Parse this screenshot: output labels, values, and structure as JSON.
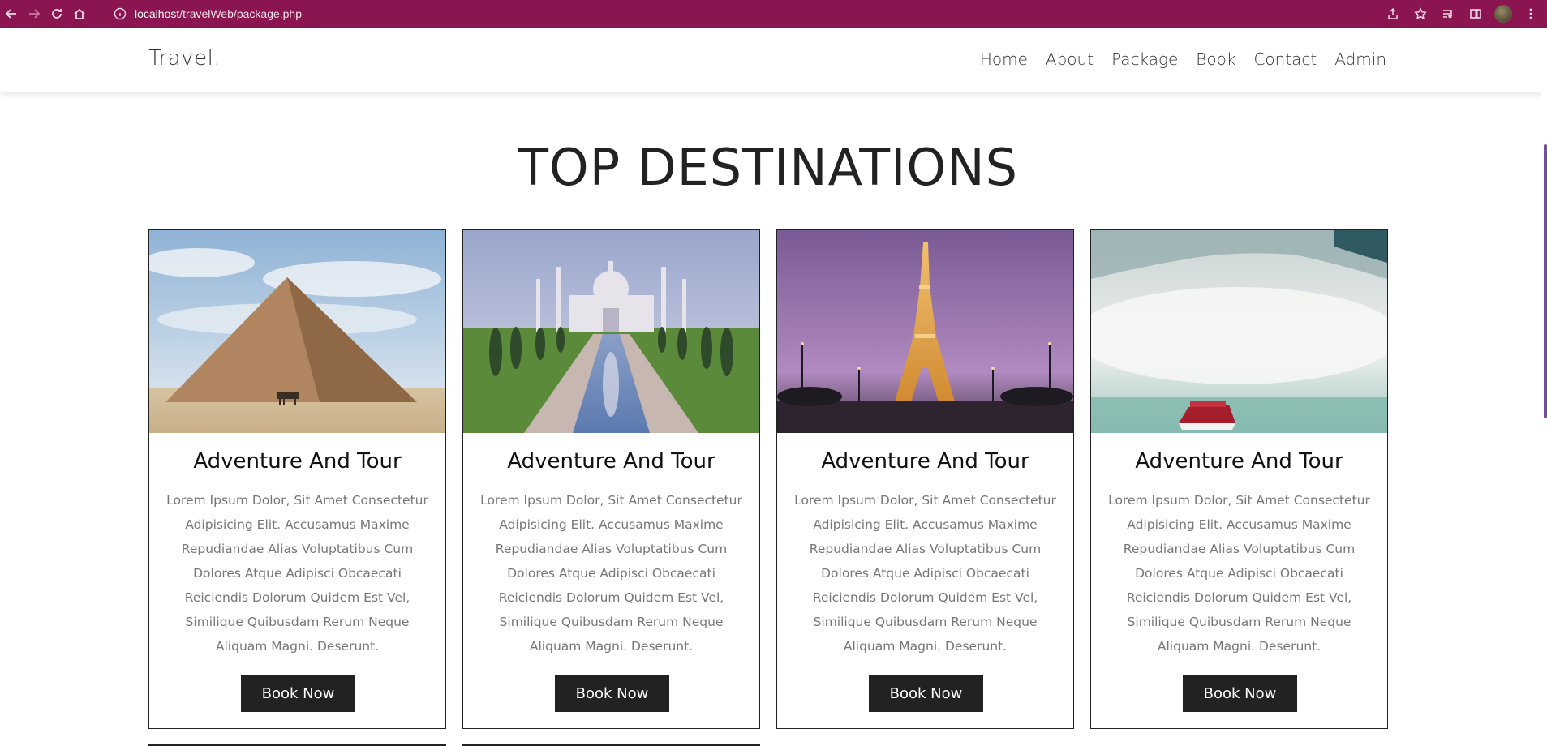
{
  "browser": {
    "url_host": "localhost",
    "url_path": "/travelWeb/package.php"
  },
  "site": {
    "brand": "Travel.",
    "nav": [
      "Home",
      "About",
      "Package",
      "Book",
      "Contact",
      "Admin"
    ]
  },
  "section": {
    "title": "TOP DESTINATIONS"
  },
  "cards": [
    {
      "image": "pyramid-photo",
      "title": "Adventure And Tour",
      "description": "Lorem Ipsum Dolor, Sit Amet Consectetur Adipisicing Elit. Accusamus Maxime Repudiandae Alias Voluptatibus Cum Dolores Atque Adipisci Obcaecati Reiciendis Dolorum Quidem Est Vel, Similique Quibusdam Rerum Neque Aliquam Magni. Deserunt.",
      "button": "Book Now"
    },
    {
      "image": "taj-mahal-photo",
      "title": "Adventure And Tour",
      "description": "Lorem Ipsum Dolor, Sit Amet Consectetur Adipisicing Elit. Accusamus Maxime Repudiandae Alias Voluptatibus Cum Dolores Atque Adipisci Obcaecati Reiciendis Dolorum Quidem Est Vel, Similique Quibusdam Rerum Neque Aliquam Magni. Deserunt.",
      "button": "Book Now"
    },
    {
      "image": "eiffel-tower-photo",
      "title": "Adventure And Tour",
      "description": "Lorem Ipsum Dolor, Sit Amet Consectetur Adipisicing Elit. Accusamus Maxime Repudiandae Alias Voluptatibus Cum Dolores Atque Adipisci Obcaecati Reiciendis Dolorum Quidem Est Vel, Similique Quibusdam Rerum Neque Aliquam Magni. Deserunt.",
      "button": "Book Now"
    },
    {
      "image": "waterfall-boat-photo",
      "title": "Adventure And Tour",
      "description": "Lorem Ipsum Dolor, Sit Amet Consectetur Adipisicing Elit. Accusamus Maxime Repudiandae Alias Voluptatibus Cum Dolores Atque Adipisci Obcaecati Reiciendis Dolorum Quidem Est Vel, Similique Quibusdam Rerum Neque Aliquam Magni. Deserunt.",
      "button": "Book Now"
    }
  ],
  "colors": {
    "browser_bar": "#8a1550",
    "button_bg": "#222222",
    "scroll_thumb": "#7a4aa0"
  }
}
